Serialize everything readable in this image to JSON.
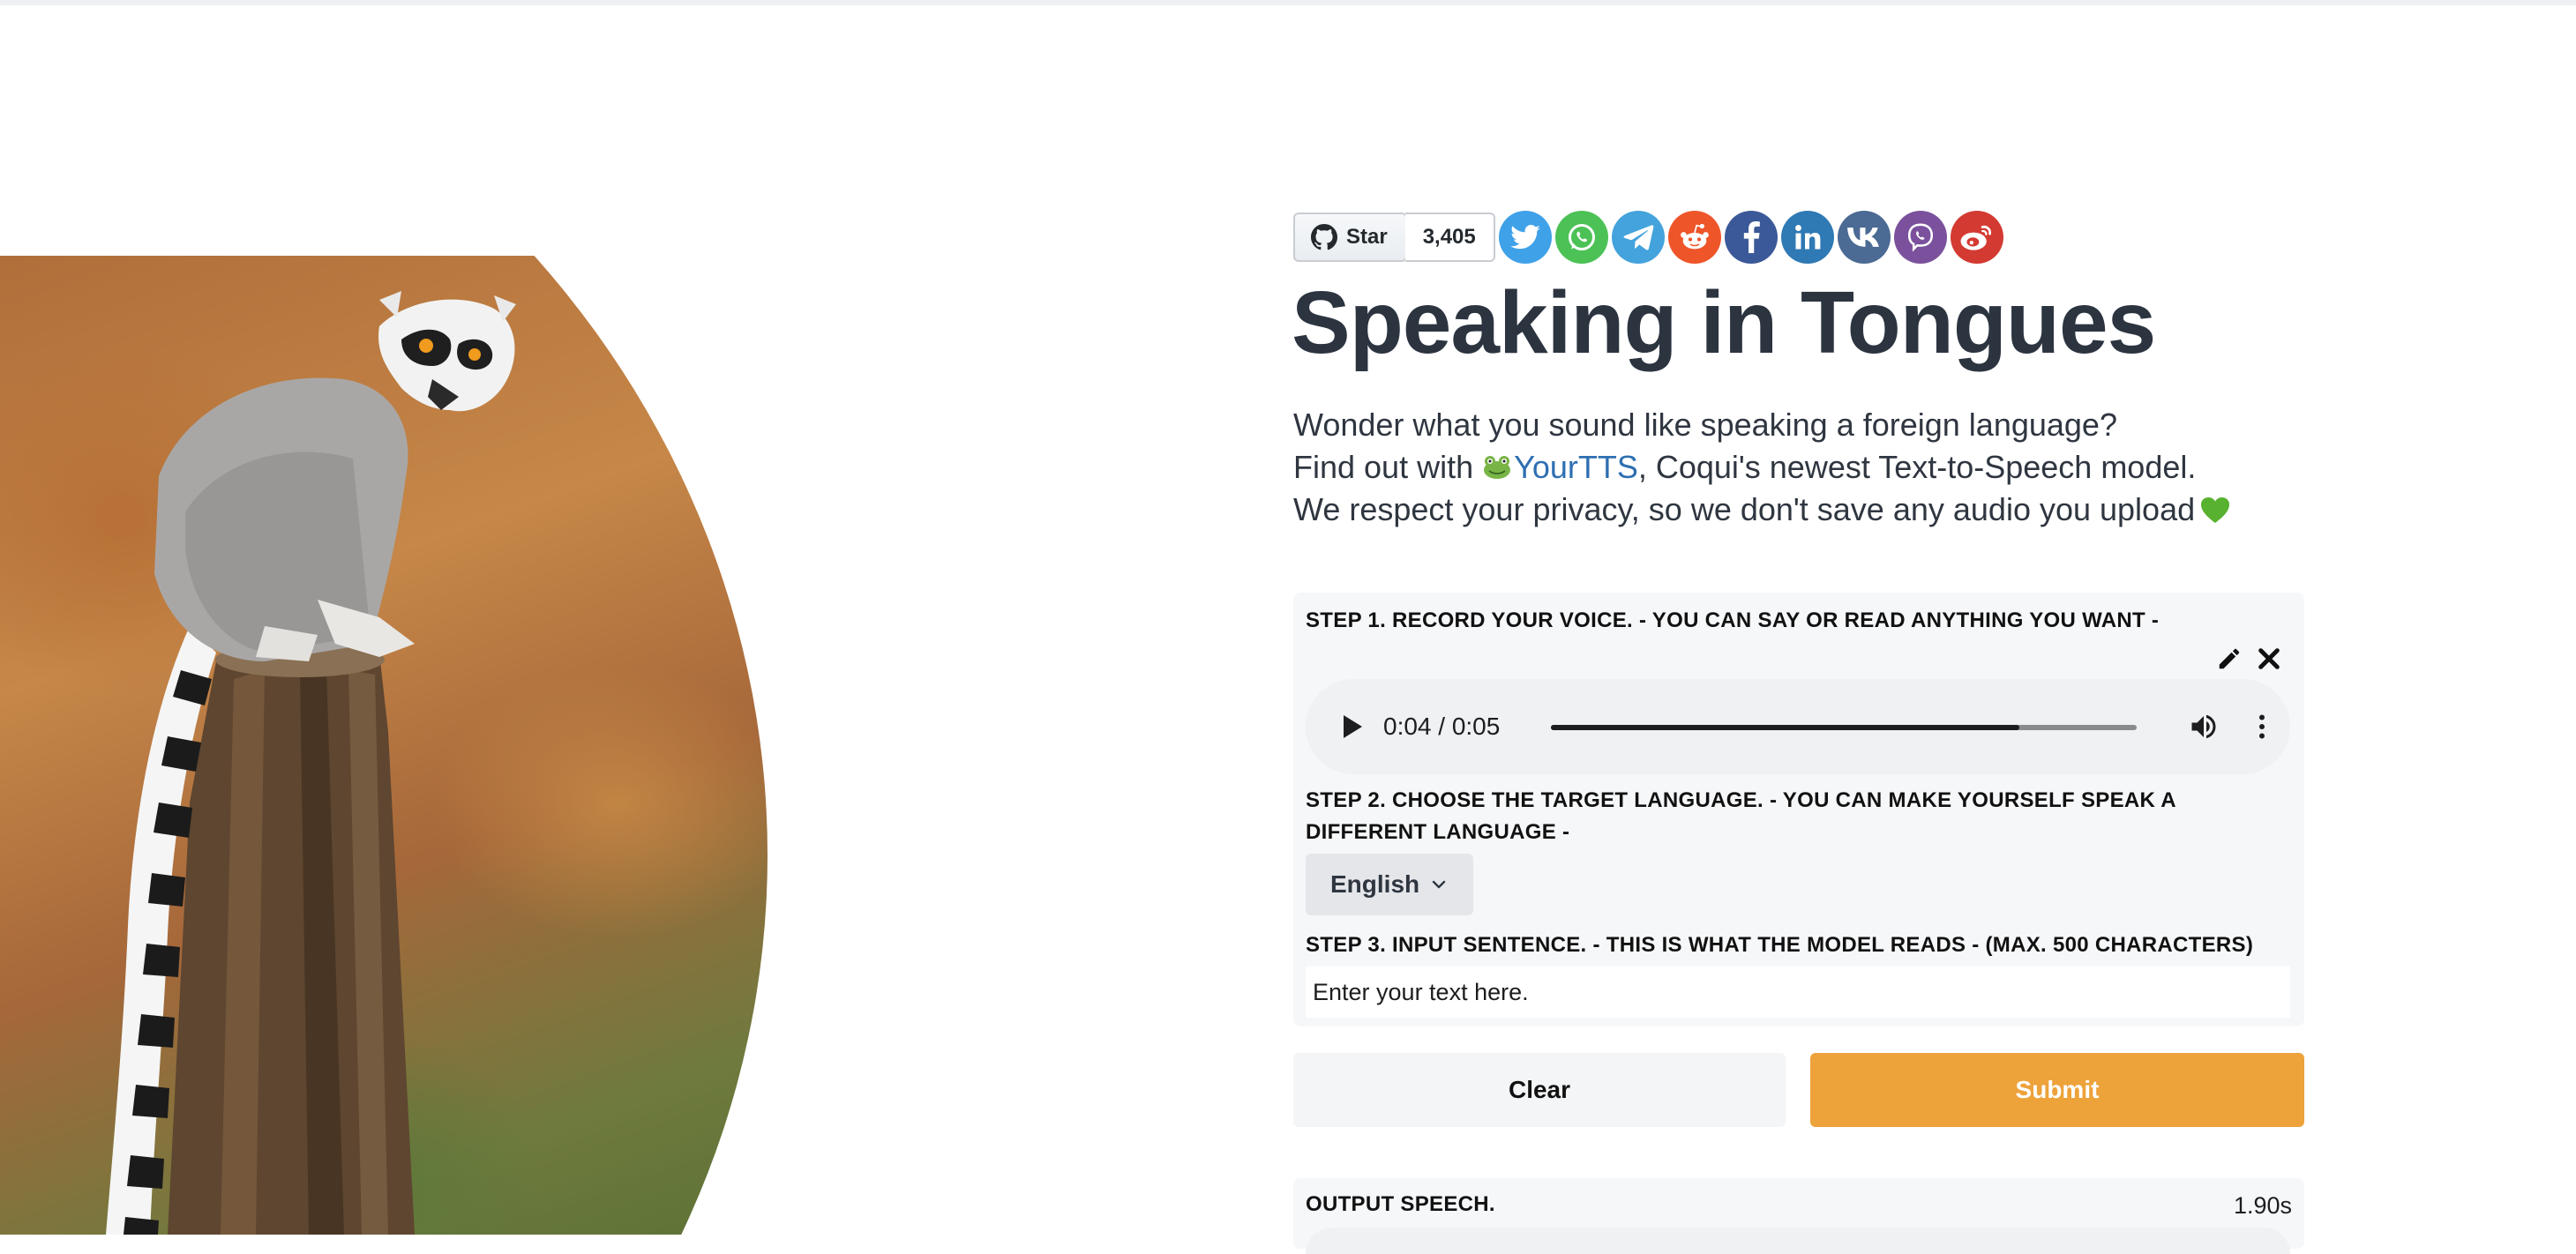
{
  "github": {
    "star_label": "Star",
    "star_count": "3,405"
  },
  "share_icons": [
    {
      "name": "twitter-icon",
      "color": "#3fa1e8"
    },
    {
      "name": "whatsapp-icon",
      "color": "#4cc256"
    },
    {
      "name": "telegram-icon",
      "color": "#44a3dc"
    },
    {
      "name": "reddit-icon",
      "color": "#ee5529"
    },
    {
      "name": "facebook-icon",
      "color": "#3b5998"
    },
    {
      "name": "linkedin-icon",
      "color": "#2f79b4"
    },
    {
      "name": "vk-icon",
      "color": "#4b6a94"
    },
    {
      "name": "viber-icon",
      "color": "#7b519d"
    },
    {
      "name": "weibo-icon",
      "color": "#d33a32"
    }
  ],
  "title": "Speaking in Tongues",
  "intro": {
    "line1": "Wonder what you sound like speaking a foreign language?",
    "line2_prefix": "Find out with ",
    "link_text": "YourTTS",
    "line2_suffix": ", Coqui's newest Text-to-Speech model.",
    "line3": "We respect your privacy, so we don't save any audio you upload"
  },
  "step1": {
    "label": "STEP 1. RECORD YOUR VOICE. - YOU CAN SAY OR READ ANYTHING YOU WANT -",
    "audio": {
      "time": "0:04 / 0:05",
      "progress": 0.8
    }
  },
  "step2": {
    "label_line1": "STEP 2. CHOOSE THE TARGET LANGUAGE. - YOU CAN MAKE YOURSELF SPEAK A",
    "label_line2": "DIFFERENT LANGUAGE -",
    "selected": "English"
  },
  "step3": {
    "label": "STEP 3. INPUT SENTENCE. - THIS IS WHAT THE MODEL READS - (MAX. 500 CHARACTERS)",
    "placeholder": "Enter your text here."
  },
  "buttons": {
    "clear": "Clear",
    "submit": "Submit"
  },
  "output": {
    "label": "OUTPUT SPEECH.",
    "duration": "1.90s"
  },
  "colors": {
    "accent": "#eda23a",
    "link": "#2f6fb2",
    "panel": "#f6f7f9"
  }
}
